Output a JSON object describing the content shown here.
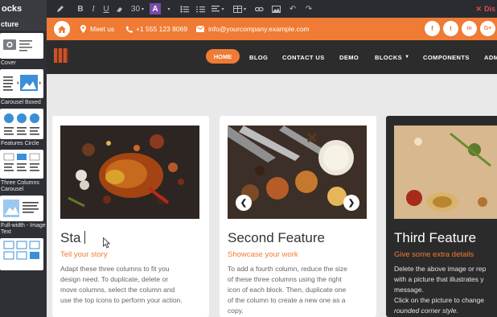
{
  "toolbar": {
    "title": "ocks",
    "font_size": "30",
    "text_color_letter": "A",
    "discard_label": "Dis"
  },
  "sidebar": {
    "header": "cture",
    "items": [
      {
        "label": "Cover"
      },
      {
        "label": "Carousel Boxed"
      },
      {
        "label": "Features Circle"
      },
      {
        "label": "Three Columns Carousel"
      },
      {
        "label": "Full-width - Image Text"
      }
    ]
  },
  "topbar": {
    "meet": "Meet us",
    "phone": "+1 555 123 8069",
    "email": "info@yourcompany.example.com",
    "social": [
      "f",
      "t",
      "in",
      "G+"
    ]
  },
  "nav": {
    "items": [
      "HOME",
      "BLOG",
      "CONTACT US",
      "DEMO",
      "BLOCKS",
      "COMPONENTS",
      "ADM"
    ]
  },
  "cards": [
    {
      "title": "Sta",
      "subtitle": "Tell your story",
      "lines": [
        "Adapt these three columns to fit you",
        "design need. To duplicate, delete or",
        "move columns, select the column and",
        "use the top icons to perform your action."
      ]
    },
    {
      "title": "Second Feature",
      "subtitle": "Showcase your work",
      "lines": [
        "To add a fourth column, reduce the size",
        "of these three columns using the right",
        "icon of each block. Then, duplicate one",
        "of the column to create a new one as a",
        "copy."
      ]
    },
    {
      "title": "Third Feature",
      "subtitle": "Give some extra details",
      "lines": [
        "Delete the above image or rep",
        "with a picture that illustrates y",
        "message.",
        "Click on the picture to change",
        "rounded corner style."
      ]
    }
  ],
  "colors": {
    "accent": "#ef7b35",
    "navbar": "#2c2c2c",
    "page": "#e9e9e9",
    "editor": "#2b2c31"
  }
}
